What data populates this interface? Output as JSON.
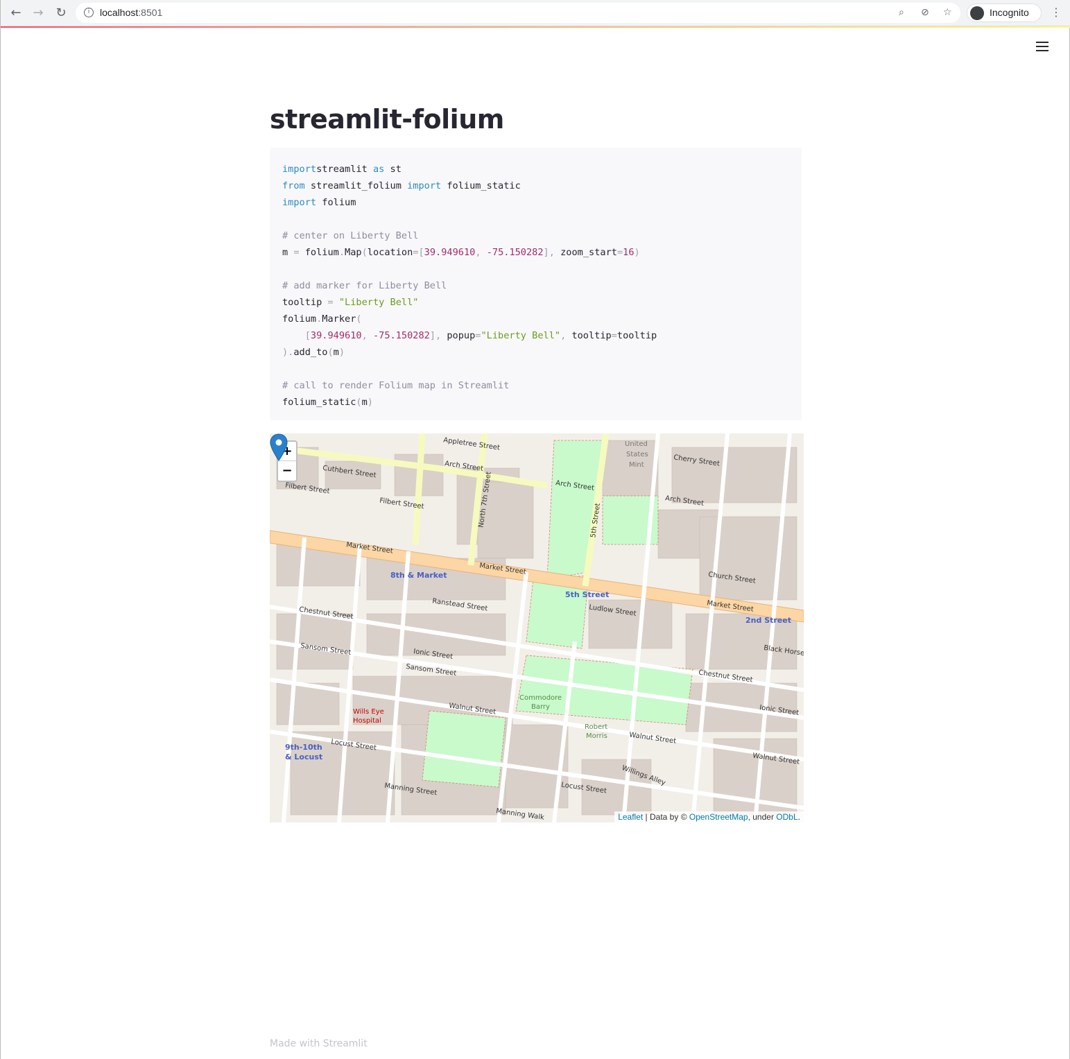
{
  "browser": {
    "url_host": "localhost",
    "url_port": ":8501",
    "profile_label": "Incognito"
  },
  "page": {
    "title": "streamlit-folium",
    "footer": "Made with Streamlit"
  },
  "code": [
    [
      [
        "kw",
        "import"
      ],
      [
        "",
        "streamlit "
      ],
      [
        "kw",
        "as"
      ],
      [
        "",
        " st"
      ]
    ],
    [
      [
        "kw",
        "from"
      ],
      [
        "",
        " streamlit_folium "
      ],
      [
        "kw",
        "import"
      ],
      [
        "",
        " folium_static"
      ]
    ],
    [
      [
        "kw",
        "import"
      ],
      [
        "",
        " folium"
      ]
    ],
    [],
    [
      [
        "cm",
        "# center on Liberty Bell"
      ]
    ],
    [
      [
        "",
        "m "
      ],
      [
        "pu",
        "="
      ],
      [
        "",
        " folium"
      ],
      [
        "pu",
        "."
      ],
      [
        "",
        "Map"
      ],
      [
        "pu",
        "("
      ],
      [
        "",
        "location"
      ],
      [
        "pu",
        "=["
      ],
      [
        "nm",
        "39.949610"
      ],
      [
        "pu",
        ", "
      ],
      [
        "nm",
        "-75.150282"
      ],
      [
        "pu",
        "], "
      ],
      [
        "",
        "zoom_start"
      ],
      [
        "pu",
        "="
      ],
      [
        "nm",
        "16"
      ],
      [
        "pu",
        ")"
      ]
    ],
    [],
    [
      [
        "cm",
        "# add marker for Liberty Bell"
      ]
    ],
    [
      [
        "",
        "tooltip "
      ],
      [
        "pu",
        "="
      ],
      [
        "st",
        " \"Liberty Bell\""
      ]
    ],
    [
      [
        "",
        "folium"
      ],
      [
        "pu",
        "."
      ],
      [
        "",
        "Marker"
      ],
      [
        "pu",
        "("
      ]
    ],
    [
      [
        "pu",
        "    ["
      ],
      [
        "nm",
        "39.949610"
      ],
      [
        "pu",
        ", "
      ],
      [
        "nm",
        "-75.150282"
      ],
      [
        "pu",
        "], "
      ],
      [
        "",
        "popup"
      ],
      [
        "pu",
        "="
      ],
      [
        "st",
        "\"Liberty Bell\""
      ],
      [
        "pu",
        ", "
      ],
      [
        "",
        "tooltip"
      ],
      [
        "pu",
        "="
      ],
      [
        "",
        "tooltip"
      ]
    ],
    [
      [
        "pu",
        ")."
      ],
      [
        "",
        "add_to"
      ],
      [
        "pu",
        "("
      ],
      [
        "",
        "m"
      ],
      [
        "pu",
        ")"
      ]
    ],
    [],
    [
      [
        "cm",
        "# call to render Folium map in Streamlit"
      ]
    ],
    [
      [
        "",
        "folium_static"
      ],
      [
        "pu",
        "("
      ],
      [
        "",
        "m"
      ],
      [
        "pu",
        ")"
      ]
    ]
  ],
  "map": {
    "zoom_in": "+",
    "zoom_out": "−",
    "attribution": {
      "leaflet": "Leaflet",
      "sep": " | Data by © ",
      "osm": "OpenStreetMap",
      "under": ", under ",
      "odbl": "ODbL",
      "end": "."
    },
    "labels": {
      "appletree": "Appletree Street",
      "arch1": "Arch Street",
      "arch2": "Arch Street",
      "arch3": "Arch Street",
      "cuthbert": "Cuthbert Street",
      "filbert1": "Filbert Street",
      "filbert2": "Filbert Street",
      "market1": "Market Street",
      "market2": "Market Street",
      "market3": "Market Street",
      "eighth_market": "8th & Market",
      "fifth_street": "5th Street",
      "second_street": "2nd Street",
      "chestnut1": "Chestnut Street",
      "chestnut2": "Chestnut Street",
      "sansom1": "Sansom Street",
      "sansom2": "Sansom Street",
      "ionic1": "Ionic Street",
      "ionic2": "Ionic Street",
      "ranstead": "Ranstead Street",
      "ludlow": "Ludlow Street",
      "walnut1": "Walnut Street",
      "walnut2": "Walnut Street",
      "walnut3": "Walnut Street",
      "locust1": "Locust Street",
      "locust2": "Locust Street",
      "manning1": "Manning Street",
      "manning2": "Manning Walk",
      "mint1": "United",
      "mint2": "States",
      "mint3": "Mint",
      "cherry": "Cherry Street",
      "church": "Church Street",
      "black_horse": "Black Horse",
      "commodore1": "Commodore",
      "commodore2": "Barry",
      "robert1": "Robert",
      "robert2": "Morris",
      "wills1": "Wills Eye",
      "wills2": "Hospital",
      "ninth_tenth1": "9th-10th",
      "ninth_tenth2": "& Locust",
      "willings": "Willings Alley",
      "n7th": "North 7th Street",
      "s5th": "5th Street"
    },
    "colors": {
      "primary_road": "#fcd6a4",
      "secondary_road": "#f7fabf",
      "park": "#c8facc",
      "building": "#d9d0c9",
      "marker": "#2a81cb"
    }
  }
}
